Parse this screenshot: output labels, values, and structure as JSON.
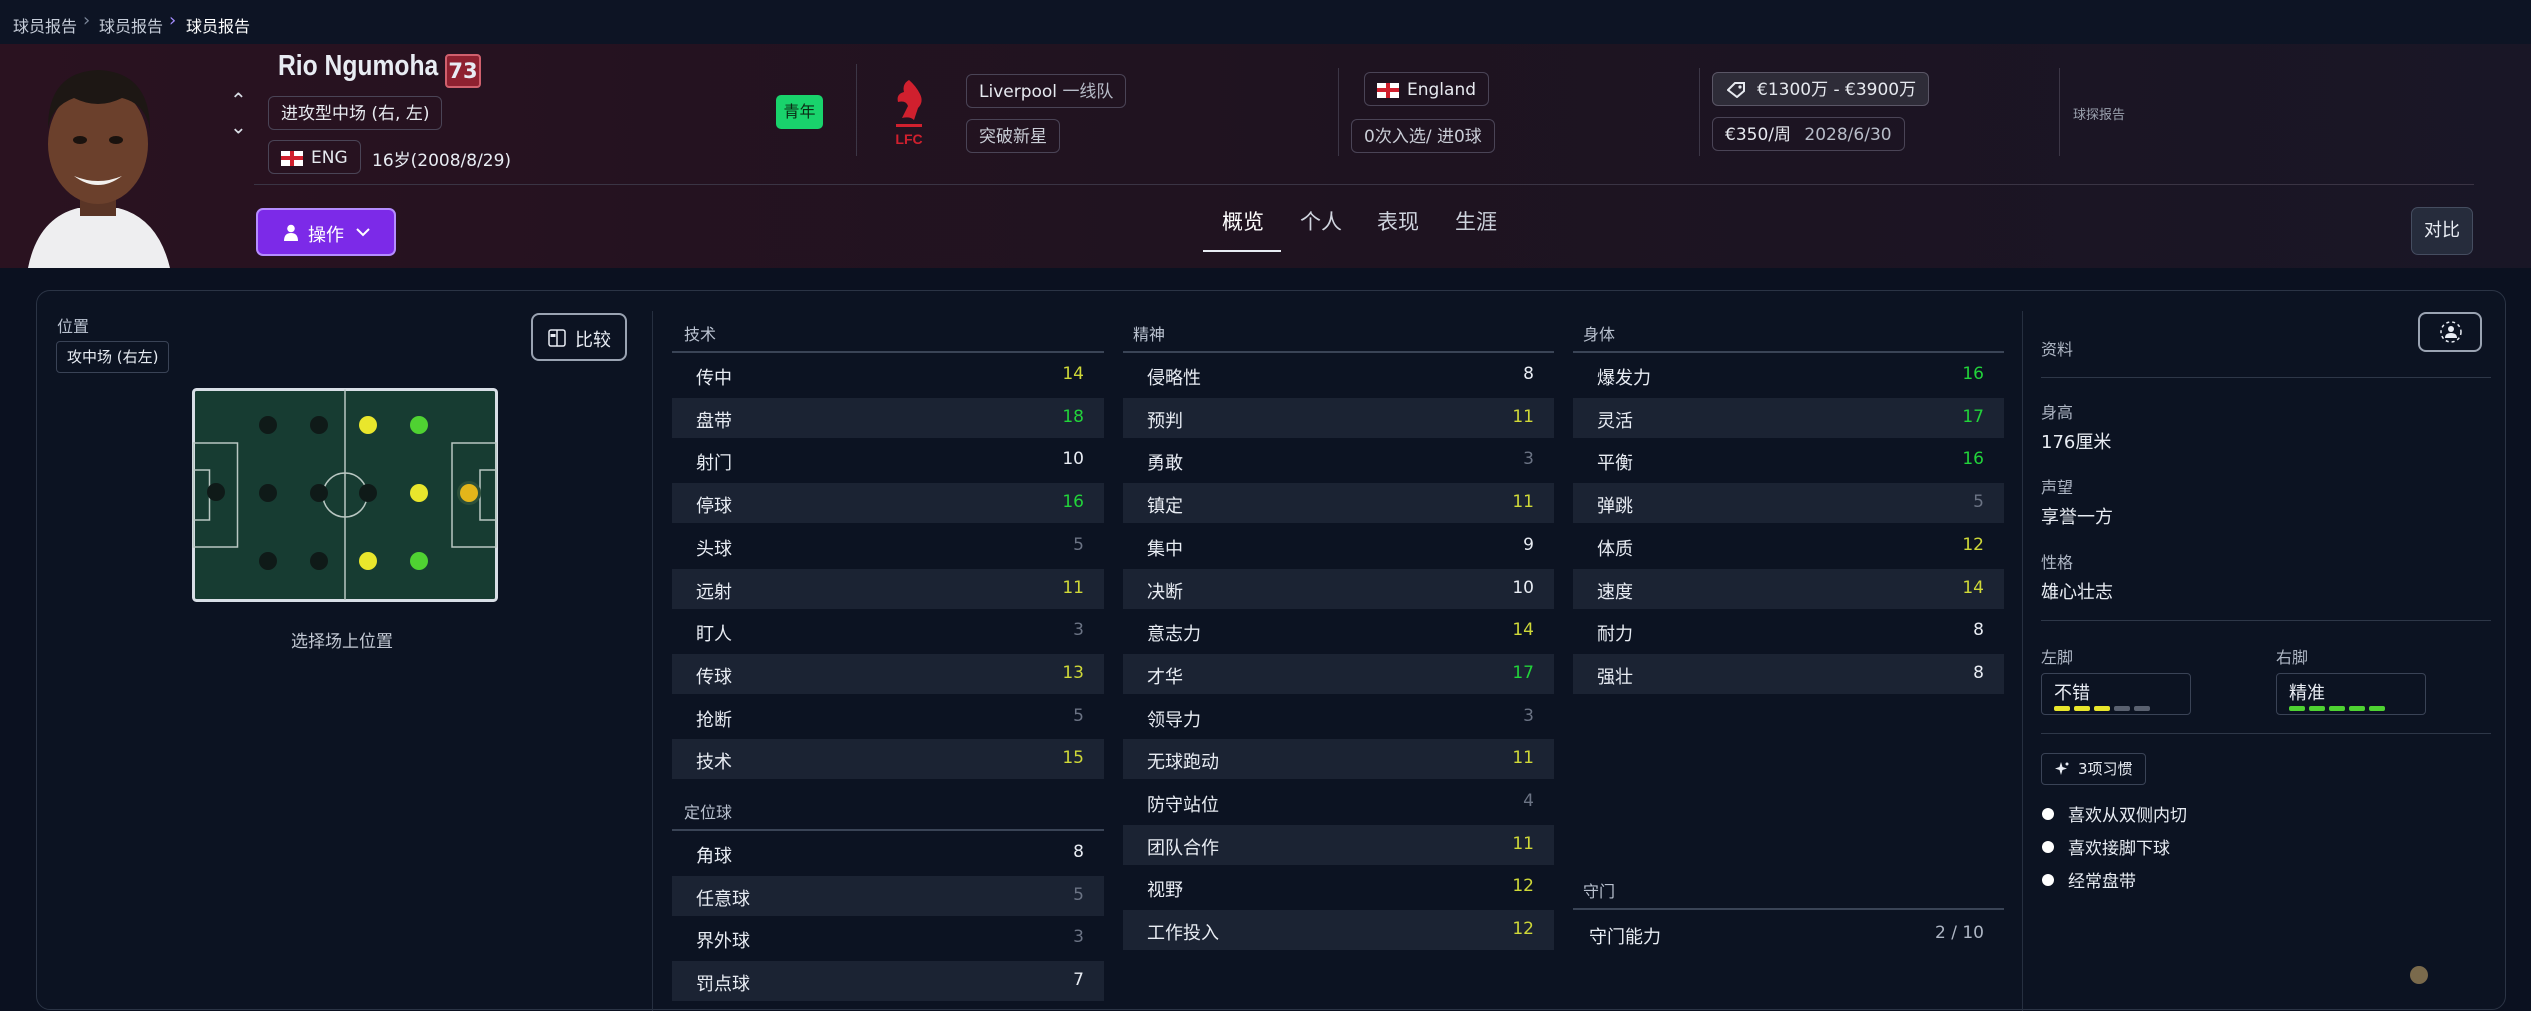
{
  "breadcrumb": [
    "球员报告",
    "球员报告",
    "球员报告"
  ],
  "player": {
    "name": "Rio Ngumoha",
    "rating": "73",
    "position": "进攻型中场 (右, 左)",
    "nation_code": "ENG",
    "age": "16岁(2008/8/29)",
    "youth_badge": "青年",
    "club": "Liverpool",
    "squad": "一线队",
    "status": "突破新星",
    "nationality": "England",
    "caps": "0次入选/ 进0球",
    "value": "€1300万 - €3900万",
    "wage": "€350/周",
    "contract_end": "2028/6/30",
    "scout_label": "球探报告"
  },
  "actions": {
    "action_label": "操作",
    "compare_label": "对比",
    "compare2_label": "比较"
  },
  "tabs": [
    "概览",
    "个人",
    "表现",
    "生涯"
  ],
  "colors": {
    "accent": "#7c2ae8",
    "high": "#22d33a",
    "mid": "#cfd838",
    "low": "#6b7384",
    "youth": "#19d36c",
    "rating": "#8e2130"
  },
  "position_panel": {
    "title": "位置",
    "current": "攻中场 (右左)",
    "hint": "选择场上位置"
  },
  "attributes": {
    "technical": {
      "title": "技术",
      "items": [
        {
          "label": "传中",
          "value": "14",
          "tier": "mid"
        },
        {
          "label": "盘带",
          "value": "18",
          "tier": "hi"
        },
        {
          "label": "射门",
          "value": "10",
          "tier": "n"
        },
        {
          "label": "停球",
          "value": "16",
          "tier": "hi"
        },
        {
          "label": "头球",
          "value": "5",
          "tier": "lo"
        },
        {
          "label": "远射",
          "value": "11",
          "tier": "mid"
        },
        {
          "label": "盯人",
          "value": "3",
          "tier": "lo"
        },
        {
          "label": "传球",
          "value": "13",
          "tier": "mid"
        },
        {
          "label": "抢断",
          "value": "5",
          "tier": "lo"
        },
        {
          "label": "技术",
          "value": "15",
          "tier": "mid"
        }
      ]
    },
    "set_pieces": {
      "title": "定位球",
      "items": [
        {
          "label": "角球",
          "value": "8",
          "tier": "n"
        },
        {
          "label": "任意球",
          "value": "5",
          "tier": "lo"
        },
        {
          "label": "界外球",
          "value": "3",
          "tier": "lo"
        },
        {
          "label": "罚点球",
          "value": "7",
          "tier": "n"
        }
      ]
    },
    "mental": {
      "title": "精神",
      "items": [
        {
          "label": "侵略性",
          "value": "8",
          "tier": "n"
        },
        {
          "label": "预判",
          "value": "11",
          "tier": "mid"
        },
        {
          "label": "勇敢",
          "value": "3",
          "tier": "lo"
        },
        {
          "label": "镇定",
          "value": "11",
          "tier": "mid"
        },
        {
          "label": "集中",
          "value": "9",
          "tier": "n"
        },
        {
          "label": "决断",
          "value": "10",
          "tier": "n"
        },
        {
          "label": "意志力",
          "value": "14",
          "tier": "mid"
        },
        {
          "label": "才华",
          "value": "17",
          "tier": "hi"
        },
        {
          "label": "领导力",
          "value": "3",
          "tier": "lo"
        },
        {
          "label": "无球跑动",
          "value": "11",
          "tier": "mid"
        },
        {
          "label": "防守站位",
          "value": "4",
          "tier": "lo"
        },
        {
          "label": "团队合作",
          "value": "11",
          "tier": "mid"
        },
        {
          "label": "视野",
          "value": "12",
          "tier": "mid"
        },
        {
          "label": "工作投入",
          "value": "12",
          "tier": "mid"
        }
      ]
    },
    "physical": {
      "title": "身体",
      "items": [
        {
          "label": "爆发力",
          "value": "16",
          "tier": "hi"
        },
        {
          "label": "灵活",
          "value": "17",
          "tier": "hi"
        },
        {
          "label": "平衡",
          "value": "16",
          "tier": "hi"
        },
        {
          "label": "弹跳",
          "value": "5",
          "tier": "lo"
        },
        {
          "label": "体质",
          "value": "12",
          "tier": "mid"
        },
        {
          "label": "速度",
          "value": "14",
          "tier": "mid"
        },
        {
          "label": "耐力",
          "value": "8",
          "tier": "n"
        },
        {
          "label": "强壮",
          "value": "8",
          "tier": "n"
        }
      ]
    },
    "goalkeeping": {
      "title": "守门",
      "label": "守门能力",
      "value": "2 / 10"
    }
  },
  "profile": {
    "title": "资料",
    "height_label": "身高",
    "height": "176厘米",
    "reputation_label": "声望",
    "reputation": "享誉一方",
    "personality_label": "性格",
    "personality": "雄心壮志",
    "left_foot_label": "左脚",
    "left_foot": "不错",
    "left_foot_level": 3,
    "right_foot_label": "右脚",
    "right_foot": "精准",
    "right_foot_level": 5,
    "habits_label": "3项习惯",
    "habits": [
      "喜欢从双侧内切",
      "喜欢接脚下球",
      "经常盘带"
    ]
  }
}
